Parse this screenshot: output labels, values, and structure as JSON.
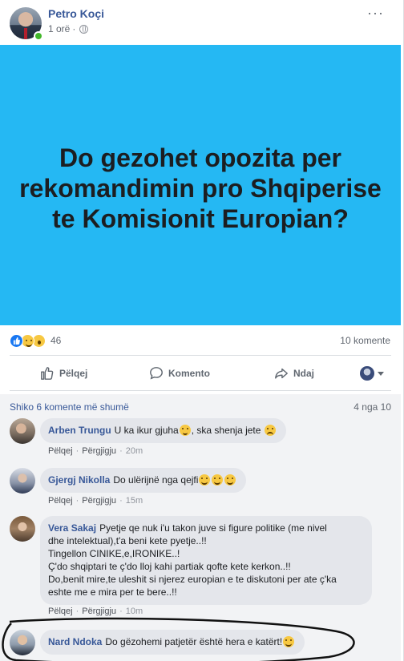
{
  "post": {
    "author": "Petro Koçi",
    "time": "1 orë",
    "time_separator": "·",
    "more": "···",
    "image_text_lines": [
      "Do gezohet opozita per",
      "rekomandimin pro Shqiperise",
      "te Komisionit Europian?"
    ],
    "reactions": {
      "icons": [
        "like-icon",
        "haha-icon",
        "wow-icon"
      ],
      "count": "46"
    },
    "comments_count": "10 komente",
    "actions": {
      "like": "Pëlqej",
      "comment": "Komento",
      "share": "Ndaj"
    }
  },
  "comments_section": {
    "view_more": "Shiko 6 komente më shumë",
    "pager": "4 nga 10",
    "like_label": "Pëlqej",
    "reply_label": "Përgjigju",
    "separator": "·",
    "items": [
      {
        "author": "Arben Trungu",
        "text": "U ka ikur gjuha",
        "text2": ", ska shenja jete",
        "time": "20m",
        "emoji": [
          "thinking-emoji",
          "sad-emoji"
        ]
      },
      {
        "author": "Gjergj Nikolla",
        "text": "Do ulërijnë nga qejfi",
        "time": "15m",
        "emoji": [
          "grin-emoji",
          "grin-emoji",
          "grin-emoji"
        ]
      },
      {
        "author": "Vera Sakaj",
        "lines": [
          "Pyetje qe nuk i'u takon juve si figure politike (me nivel",
          "dhe intelektual),t'a beni kete pyetje..!!",
          "Tingellon CINIKE,e,IRONIKE..!",
          "Ç'do shqiptari te ç'do lloj kahi partiak qofte kete kerkon..!!",
          "Do,benit mire,te uleshit si njerez europian e te diskutoni per ate ç'ka",
          "eshte me e mira per te bere..!!"
        ],
        "time": "10m"
      },
      {
        "author": "Nard Ndoka",
        "text": "Do gëzohemi patjetër është hera e katërt!",
        "emoji": [
          "smile-emoji"
        ]
      }
    ]
  },
  "colors": {
    "image_bg": "#25b8f3",
    "link": "#385898",
    "bubble": "#e4e6eb",
    "online": "#42b72a"
  }
}
